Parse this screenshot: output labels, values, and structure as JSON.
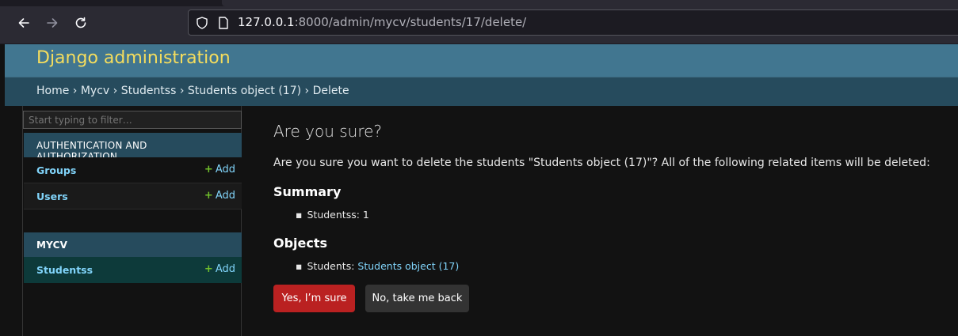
{
  "browser": {
    "url_host": "127.0.0.1",
    "url_rest": ":8000/admin/mycv/students/17/delete/"
  },
  "header": {
    "brand": "Django administration"
  },
  "breadcrumbs": {
    "text": "Home › Mycv › Studentss › Students object (17) › Delete"
  },
  "sidebar": {
    "filter_placeholder": "Start typing to filter…",
    "auth_caption": "AUTHENTICATION AND AUTHORIZATION",
    "groups": "Groups",
    "users": "Users",
    "mycv_caption": "MYCV",
    "studentss": "Studentss",
    "add_label": "Add",
    "add_symbol": "+"
  },
  "content": {
    "title": "Are you sure?",
    "question": "Are you sure you want to delete the students \"Students object (17)\"? All of the following related items will be deleted:",
    "summary_heading": "Summary",
    "summary_item": "Studentss: 1",
    "objects_heading": "Objects",
    "objects_prefix": "Students: ",
    "objects_link": "Students object (17)",
    "confirm_button": "Yes, I’m sure",
    "cancel_button": "No, take me back"
  },
  "colors": {
    "header_bg": "#417690",
    "brand_text": "#f5dd5d",
    "breadcrumbs_bg": "#264b5d",
    "link": "#81d4fa",
    "add_plus": "#70bf2b",
    "delete_button": "#ba2121",
    "cancel_button": "#333333"
  },
  "icons": [
    "back-arrow-icon",
    "forward-arrow-icon",
    "reload-icon",
    "shield-icon",
    "page-icon",
    "add-plus-icon"
  ]
}
